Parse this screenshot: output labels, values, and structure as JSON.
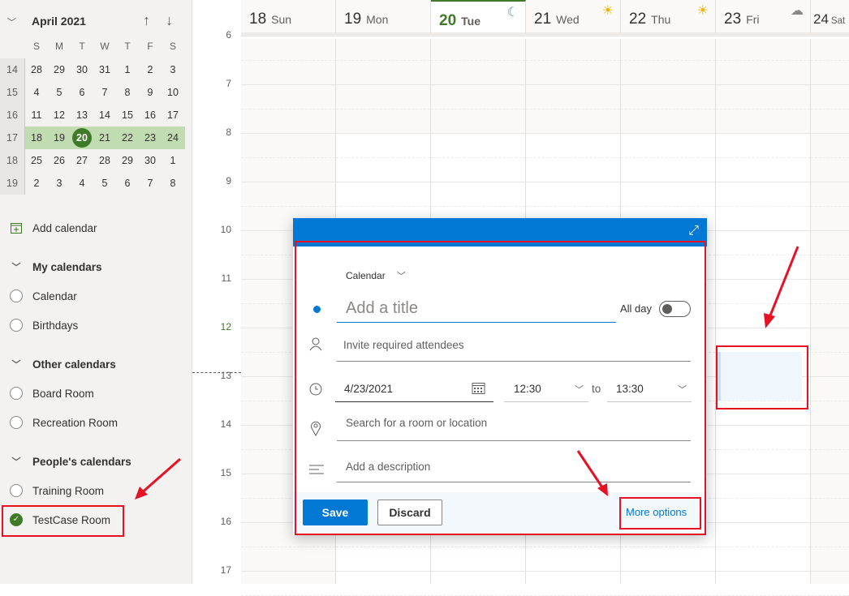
{
  "mini_calendar": {
    "month_label": "April 2021",
    "weekday_headers": [
      "S",
      "M",
      "T",
      "W",
      "T",
      "F",
      "S"
    ],
    "weeks": [
      {
        "week": "14",
        "days": [
          "28",
          "29",
          "30",
          "31",
          "1",
          "2",
          "3"
        ]
      },
      {
        "week": "15",
        "days": [
          "4",
          "5",
          "6",
          "7",
          "8",
          "9",
          "10"
        ]
      },
      {
        "week": "16",
        "days": [
          "11",
          "12",
          "13",
          "14",
          "15",
          "16",
          "17"
        ]
      },
      {
        "week": "17",
        "days": [
          "18",
          "19",
          "20",
          "21",
          "22",
          "23",
          "24"
        ],
        "current": true
      },
      {
        "week": "18",
        "days": [
          "25",
          "26",
          "27",
          "28",
          "29",
          "30",
          "1"
        ]
      },
      {
        "week": "19",
        "days": [
          "2",
          "3",
          "4",
          "5",
          "6",
          "7",
          "8"
        ]
      }
    ],
    "today": "20"
  },
  "sidebar": {
    "add_calendar": "Add calendar",
    "sections": [
      {
        "title": "My calendars",
        "items": [
          {
            "label": "Calendar",
            "checked": false
          },
          {
            "label": "Birthdays",
            "checked": false
          }
        ]
      },
      {
        "title": "Other calendars",
        "items": [
          {
            "label": "Board Room",
            "checked": false
          },
          {
            "label": "Recreation Room",
            "checked": false
          }
        ]
      },
      {
        "title": "People's calendars",
        "items": [
          {
            "label": "Training Room",
            "checked": false
          },
          {
            "label": "TestCase Room",
            "checked": true
          }
        ]
      }
    ]
  },
  "week_view": {
    "days": [
      {
        "num": "18",
        "name": "Sun",
        "weather": ""
      },
      {
        "num": "19",
        "name": "Mon",
        "weather": ""
      },
      {
        "num": "20",
        "name": "Tue",
        "weather": "moon-icon",
        "today": true
      },
      {
        "num": "21",
        "name": "Wed",
        "weather": "sun-icon"
      },
      {
        "num": "22",
        "name": "Thu",
        "weather": "sun-icon"
      },
      {
        "num": "23",
        "name": "Fri",
        "weather": "cloud-icon"
      },
      {
        "num": "24",
        "name": "Sat",
        "weather": ""
      }
    ],
    "hours": [
      "6",
      "7",
      "8",
      "9",
      "10",
      "11",
      "12",
      "13",
      "14",
      "15",
      "16",
      "17"
    ],
    "current_hour": "12"
  },
  "popup": {
    "calendar_select": "Calendar",
    "title_placeholder": "Add a title",
    "all_day_label": "All day",
    "all_day": false,
    "attendees_placeholder": "Invite required attendees",
    "date": "4/23/2021",
    "start_time": "12:30",
    "to_label": "to",
    "end_time": "13:30",
    "location_placeholder": "Search for a room or location",
    "description_placeholder": "Add a description",
    "save": "Save",
    "discard": "Discard",
    "more_options": "More options"
  },
  "colors": {
    "accent": "#0078d4",
    "today": "#3f7a27",
    "week_highlight": "#c2dcb1",
    "annotation": "#e81123"
  }
}
